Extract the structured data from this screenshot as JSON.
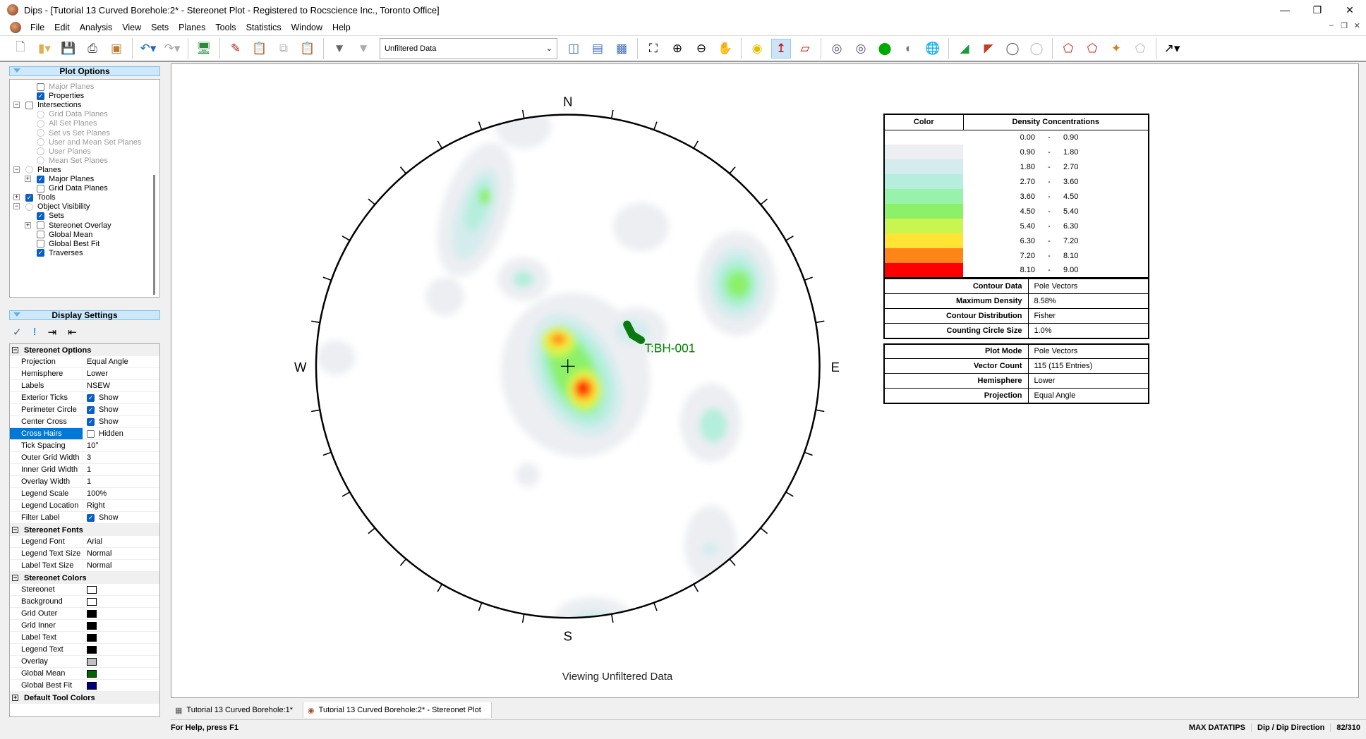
{
  "window": {
    "title": "Dips - [Tutorial 13 Curved Borehole:2* - Stereonet Plot - Registered to Rocscience Inc., Toronto Office]"
  },
  "menu": [
    "File",
    "Edit",
    "Analysis",
    "View",
    "Sets",
    "Planes",
    "Tools",
    "Statistics",
    "Window",
    "Help"
  ],
  "toolbar": {
    "filter_value": "Unfiltered Data"
  },
  "plot_options": {
    "title": "Plot Options",
    "items": [
      {
        "label": "Major Planes",
        "type": "check",
        "checked": false,
        "disabled": true
      },
      {
        "label": "Properties",
        "type": "check",
        "checked": true
      },
      {
        "label": "Intersections",
        "type": "check",
        "checked": false
      },
      {
        "label": "Grid Data Planes",
        "type": "radio",
        "disabled": true
      },
      {
        "label": "All Set Planes",
        "type": "radio",
        "disabled": true
      },
      {
        "label": "Set vs Set Planes",
        "type": "radio",
        "disabled": true
      },
      {
        "label": "User and Mean Set Planes",
        "type": "radio",
        "disabled": true
      },
      {
        "label": "User Planes",
        "type": "radio",
        "disabled": true
      },
      {
        "label": "Mean Set Planes",
        "type": "radio",
        "disabled": true
      },
      {
        "label": "Planes",
        "type": "node"
      },
      {
        "label": "Major Planes",
        "type": "check",
        "checked": true
      },
      {
        "label": "Grid Data Planes",
        "type": "check",
        "checked": false
      },
      {
        "label": "Tools",
        "type": "check",
        "checked": true
      },
      {
        "label": "Object Visibility",
        "type": "node"
      },
      {
        "label": "Sets",
        "type": "check",
        "checked": true
      },
      {
        "label": "Stereonet Overlay",
        "type": "check",
        "checked": false
      },
      {
        "label": "Global Mean",
        "type": "check",
        "checked": false
      },
      {
        "label": "Global Best Fit",
        "type": "check",
        "checked": false
      },
      {
        "label": "Traverses",
        "type": "check",
        "checked": true
      }
    ]
  },
  "display_settings": {
    "title": "Display Settings",
    "sections": [
      {
        "title": "Stereonet Options",
        "rows": [
          {
            "key": "Projection",
            "value": "Equal Angle"
          },
          {
            "key": "Hemisphere",
            "value": "Lower"
          },
          {
            "key": "Labels",
            "value": "NSEW"
          },
          {
            "key": "Exterior Ticks",
            "value": "Show",
            "check": true
          },
          {
            "key": "Perimeter Circle",
            "value": "Show",
            "check": true
          },
          {
            "key": "Center Cross",
            "value": "Show",
            "check": true
          },
          {
            "key": "Cross Hairs",
            "value": "Hidden",
            "check": false,
            "selected": true
          },
          {
            "key": "Tick Spacing",
            "value": "10°"
          },
          {
            "key": "Outer Grid Width",
            "value": "3"
          },
          {
            "key": "Inner Grid Width",
            "value": "1"
          },
          {
            "key": "Overlay Width",
            "value": "1"
          },
          {
            "key": "Legend Scale",
            "value": "100%"
          },
          {
            "key": "Legend Location",
            "value": "Right"
          },
          {
            "key": "Filter Label",
            "value": "Show",
            "check": true
          }
        ]
      },
      {
        "title": "Stereonet Fonts",
        "rows": [
          {
            "key": "Legend Font",
            "value": "Arial"
          },
          {
            "key": "Legend Text Size",
            "value": "Normal"
          },
          {
            "key": "Label Text Size",
            "value": "Normal"
          }
        ]
      },
      {
        "title": "Stereonet Colors",
        "rows": [
          {
            "key": "Stereonet",
            "color": "#ffffff"
          },
          {
            "key": "Background",
            "color": "#ffffff"
          },
          {
            "key": "Grid Outer",
            "color": "#000000"
          },
          {
            "key": "Grid Inner",
            "color": "#000000"
          },
          {
            "key": "Label Text",
            "color": "#000000"
          },
          {
            "key": "Legend Text",
            "color": "#000000"
          },
          {
            "key": "Overlay",
            "color": "#c0c0c0"
          },
          {
            "key": "Global Mean",
            "color": "#006400"
          },
          {
            "key": "Global Best Fit",
            "color": "#000080"
          }
        ]
      },
      {
        "title": "Default Tool Colors",
        "rows": [],
        "collapsed": true
      }
    ]
  },
  "stereonet": {
    "labels": {
      "n": "N",
      "s": "S",
      "e": "E",
      "w": "W"
    },
    "traverse_label": "T:BH-001",
    "traverse_color": "#008000",
    "filter_label": "Viewing Unfiltered Data"
  },
  "legend": {
    "color_header": "Color",
    "density_header": "Density Concentrations",
    "bins": [
      {
        "lo": "0.00",
        "hi": "0.90",
        "color": "#ffffff"
      },
      {
        "lo": "0.90",
        "hi": "1.80",
        "color": "#eceef2"
      },
      {
        "lo": "1.80",
        "hi": "2.70",
        "color": "#d5ecee"
      },
      {
        "lo": "2.70",
        "hi": "3.60",
        "color": "#b5eedd"
      },
      {
        "lo": "3.60",
        "hi": "4.50",
        "color": "#99f2ab"
      },
      {
        "lo": "4.50",
        "hi": "5.40",
        "color": "#8cf068"
      },
      {
        "lo": "5.40",
        "hi": "6.30",
        "color": "#c9f550"
      },
      {
        "lo": "6.30",
        "hi": "7.20",
        "color": "#ffe335"
      },
      {
        "lo": "7.20",
        "hi": "8.10",
        "color": "#ff8518"
      },
      {
        "lo": "8.10",
        "hi": "9.00",
        "color": "#ff0000"
      }
    ],
    "info1": [
      {
        "k": "Contour Data",
        "v": "Pole Vectors"
      },
      {
        "k": "Maximum Density",
        "v": "8.58%"
      },
      {
        "k": "Contour Distribution",
        "v": "Fisher"
      },
      {
        "k": "Counting Circle Size",
        "v": "1.0%"
      }
    ],
    "info2": [
      {
        "k": "Plot Mode",
        "v": "Pole Vectors"
      },
      {
        "k": "Vector Count",
        "v": "115 (115 Entries)"
      },
      {
        "k": "Hemisphere",
        "v": "Lower"
      },
      {
        "k": "Projection",
        "v": "Equal Angle"
      }
    ]
  },
  "tabs": [
    {
      "label": "Tutorial 13 Curved Borehole:1*"
    },
    {
      "label": "Tutorial 13 Curved Borehole:2* - Stereonet Plot",
      "active": true
    }
  ],
  "status": {
    "help": "For Help, press F1",
    "max": "MAX DATATIPS",
    "mode": "Dip / Dip Direction",
    "coord": "82/310"
  }
}
